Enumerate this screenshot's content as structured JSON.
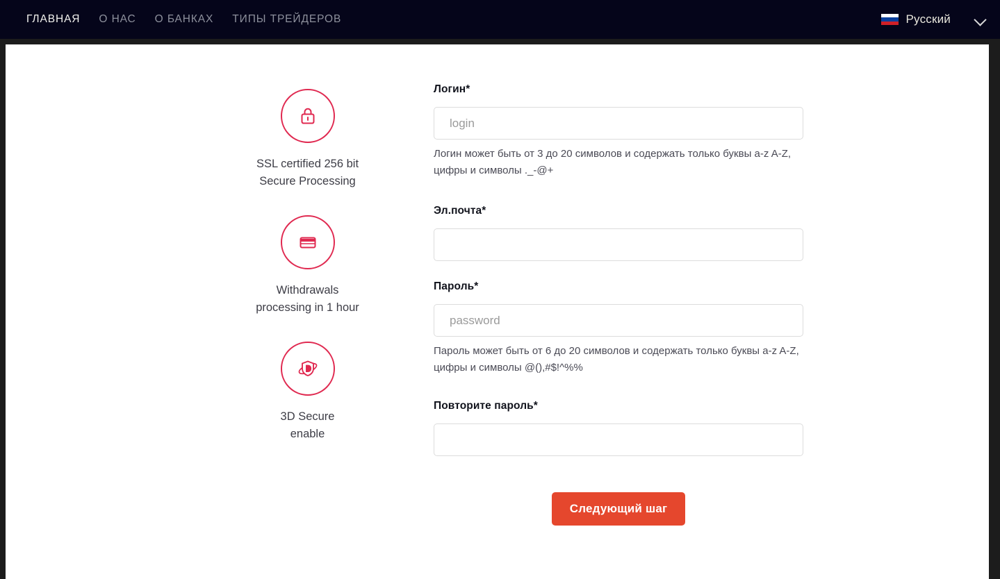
{
  "nav": {
    "items": [
      {
        "label": "ГЛАВНАЯ",
        "active": true
      },
      {
        "label": "О НАС",
        "active": false
      },
      {
        "label": "О БАНКАХ",
        "active": false
      },
      {
        "label": "ТИПЫ ТРЕЙДЕРОВ",
        "active": false
      }
    ]
  },
  "language": {
    "flag_icon": "russia-flag-icon",
    "label": "Русский",
    "chevron_icon": "chevron-down-icon"
  },
  "features": [
    {
      "icon": "lock-icon",
      "line1": "SSL certified 256 bit",
      "line2": "Secure Processing"
    },
    {
      "icon": "credit-card-icon",
      "line1": "Withdrawals",
      "line2": "processing in 1 hour"
    },
    {
      "icon": "shield-3d-secure-icon",
      "line1": "3D Secure",
      "line2": "enable"
    }
  ],
  "form": {
    "login": {
      "label": "Логин*",
      "value": "",
      "placeholder": "login",
      "hint": "Логин может быть от 3 до 20 символов и содержать только буквы a-z A-Z, цифры и символы ._-@+"
    },
    "email": {
      "label": "Эл.почта*",
      "value": "",
      "placeholder": ""
    },
    "password": {
      "label": "Пароль*",
      "value": "",
      "placeholder": "password",
      "hint": "Пароль может быть от 6 до 20 символов и содержать только буквы a-z A-Z, цифры и символы @(),#$!^%%"
    },
    "password_repeat": {
      "label": "Повторите пароль*",
      "value": "",
      "placeholder": ""
    },
    "submit_label": "Следующий шаг"
  },
  "colors": {
    "navbar_bg": "#05051a",
    "frame": "#1c1c1c",
    "accent_circle": "#e02950",
    "submit_bg": "#e5472d",
    "nav_active": "#f2f2ee",
    "nav_inactive": "#8d909c"
  }
}
